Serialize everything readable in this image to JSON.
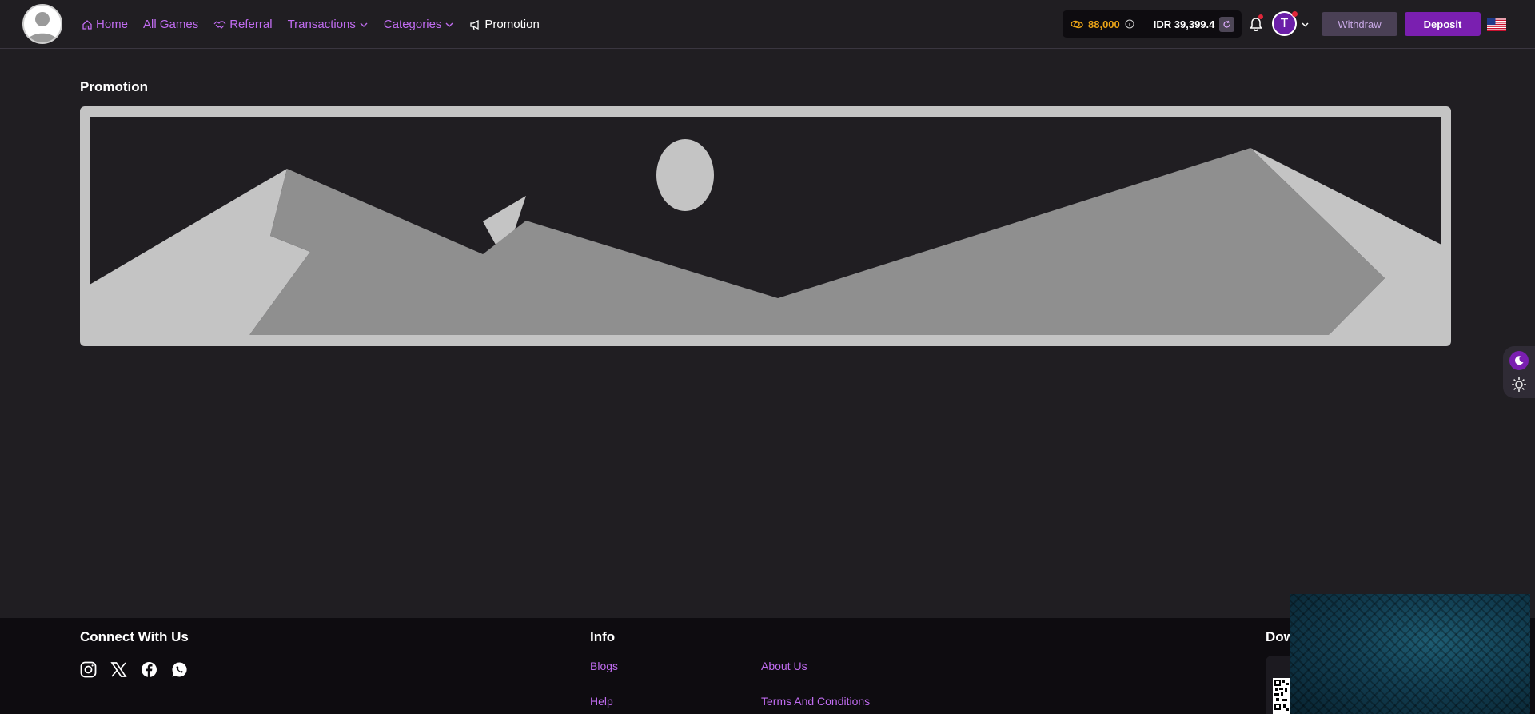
{
  "header": {
    "nav": [
      {
        "label": "Home",
        "icon": "home-icon"
      },
      {
        "label": "All Games"
      },
      {
        "label": "Referral",
        "icon": "handshake-icon"
      },
      {
        "label": "Transactions",
        "icon": "chevron-down-icon"
      },
      {
        "label": "Categories",
        "icon": "chevron-down-icon"
      },
      {
        "label": "Promotion",
        "icon": "megaphone-icon",
        "active": true
      }
    ],
    "wallet": {
      "coins": "88,000",
      "balance": "IDR 39,399.4"
    },
    "avatar_initial": "T",
    "withdraw_label": "Withdraw",
    "deposit_label": "Deposit"
  },
  "main": {
    "title": "Promotion"
  },
  "footer": {
    "connect_title": "Connect With Us",
    "info_title": "Info",
    "info_links": [
      "Blogs",
      "About Us",
      "Help",
      "Terms And Conditions"
    ],
    "download_title": "Dow"
  },
  "colors": {
    "background": "#201e22",
    "accent": "#c06cf0",
    "deposit": "#7a1fb0",
    "coins": "#e9a317",
    "footer": "#0e0c10"
  }
}
